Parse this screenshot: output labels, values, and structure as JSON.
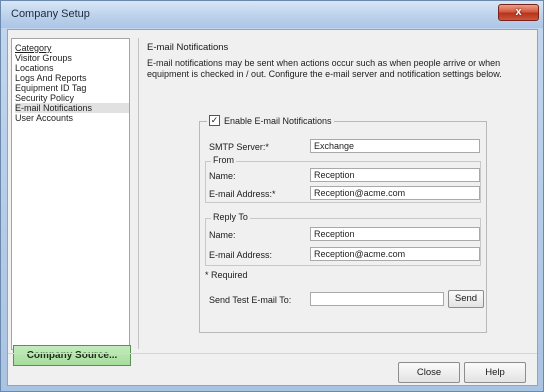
{
  "window": {
    "title": "Company Setup",
    "close_glyph": "x",
    "close_icon": "close-icon"
  },
  "sidebar": {
    "header": "Category",
    "items": [
      {
        "label": "Visitor Groups"
      },
      {
        "label": "Locations"
      },
      {
        "label": "Logs And Reports"
      },
      {
        "label": "Equipment ID Tag"
      },
      {
        "label": "Security Policy"
      },
      {
        "label": "E-mail Notifications",
        "selected": true
      },
      {
        "label": "User Accounts"
      }
    ],
    "source_button": "Company Source..."
  },
  "main": {
    "section_title": "E-mail Notifications",
    "description": "E-mail notifications may be sent when actions occur such as when people arrive or when equipment is checked in / out. Configure the e-mail server and notification settings below.",
    "enable_label": "Enable E-mail Notifications",
    "enable_checked": true,
    "smtp_label": "SMTP Server:*",
    "smtp_value": "Exchange",
    "from_title": "From",
    "from_name_label": "Name:",
    "from_name_value": "Reception",
    "from_email_label": "E-mail Address:*",
    "from_email_value": "Reception@acme.com",
    "reply_title": "Reply To",
    "reply_name_label": "Name:",
    "reply_name_value": "Reception",
    "reply_email_label": "E-mail Address:",
    "reply_email_value": "Reception@acme.com",
    "required_note": "* Required",
    "test_label": "Send Test E-mail To:",
    "test_value": "",
    "send_button": "Send"
  },
  "footer": {
    "close_button": "Close",
    "help_button": "Help"
  },
  "colors": {
    "source_button_bg": "#a6dd9c",
    "close_button_bg": "#c9563d"
  }
}
